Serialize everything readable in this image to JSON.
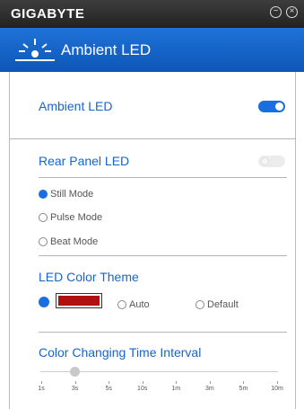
{
  "window": {
    "brand": "GIGABYTE",
    "minimize_symbol": "−",
    "close_symbol": "×"
  },
  "header": {
    "title": "Ambient LED",
    "icon": "led-light-icon",
    "colors": {
      "bar": "#1565d0",
      "accent": "#1a6fe0"
    }
  },
  "ambient_led": {
    "label": "Ambient LED",
    "enabled": true
  },
  "rear_panel": {
    "label": "Rear Panel LED",
    "enabled": false,
    "modes": [
      {
        "label": "Still Mode",
        "selected": true
      },
      {
        "label": "Pulse Mode",
        "selected": false
      },
      {
        "label": "Beat Mode",
        "selected": false
      }
    ]
  },
  "color_theme": {
    "label": "LED Color Theme",
    "swatch_color": "#b01010",
    "options": [
      {
        "label": "Auto",
        "selected": false
      },
      {
        "label": "Default",
        "selected": false
      }
    ]
  },
  "interval": {
    "label": "Color Changing Time Interval",
    "ticks": [
      "1s",
      "3s",
      "5s",
      "10s",
      "1m",
      "3m",
      "5m",
      "10m"
    ],
    "selected": "3s"
  }
}
